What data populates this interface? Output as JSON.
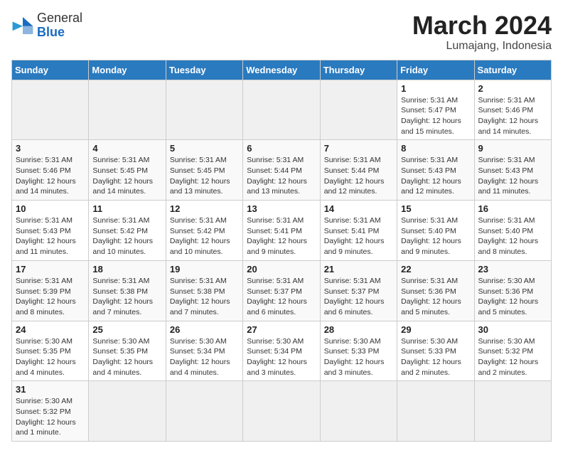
{
  "header": {
    "logo_general": "General",
    "logo_blue": "Blue",
    "month_year": "March 2024",
    "location": "Lumajang, Indonesia"
  },
  "days_of_week": [
    "Sunday",
    "Monday",
    "Tuesday",
    "Wednesday",
    "Thursday",
    "Friday",
    "Saturday"
  ],
  "weeks": [
    [
      {
        "day": "",
        "info": ""
      },
      {
        "day": "",
        "info": ""
      },
      {
        "day": "",
        "info": ""
      },
      {
        "day": "",
        "info": ""
      },
      {
        "day": "",
        "info": ""
      },
      {
        "day": "1",
        "info": "Sunrise: 5:31 AM\nSunset: 5:47 PM\nDaylight: 12 hours and 15 minutes."
      },
      {
        "day": "2",
        "info": "Sunrise: 5:31 AM\nSunset: 5:46 PM\nDaylight: 12 hours and 14 minutes."
      }
    ],
    [
      {
        "day": "3",
        "info": "Sunrise: 5:31 AM\nSunset: 5:46 PM\nDaylight: 12 hours and 14 minutes."
      },
      {
        "day": "4",
        "info": "Sunrise: 5:31 AM\nSunset: 5:45 PM\nDaylight: 12 hours and 14 minutes."
      },
      {
        "day": "5",
        "info": "Sunrise: 5:31 AM\nSunset: 5:45 PM\nDaylight: 12 hours and 13 minutes."
      },
      {
        "day": "6",
        "info": "Sunrise: 5:31 AM\nSunset: 5:44 PM\nDaylight: 12 hours and 13 minutes."
      },
      {
        "day": "7",
        "info": "Sunrise: 5:31 AM\nSunset: 5:44 PM\nDaylight: 12 hours and 12 minutes."
      },
      {
        "day": "8",
        "info": "Sunrise: 5:31 AM\nSunset: 5:43 PM\nDaylight: 12 hours and 12 minutes."
      },
      {
        "day": "9",
        "info": "Sunrise: 5:31 AM\nSunset: 5:43 PM\nDaylight: 12 hours and 11 minutes."
      }
    ],
    [
      {
        "day": "10",
        "info": "Sunrise: 5:31 AM\nSunset: 5:43 PM\nDaylight: 12 hours and 11 minutes."
      },
      {
        "day": "11",
        "info": "Sunrise: 5:31 AM\nSunset: 5:42 PM\nDaylight: 12 hours and 10 minutes."
      },
      {
        "day": "12",
        "info": "Sunrise: 5:31 AM\nSunset: 5:42 PM\nDaylight: 12 hours and 10 minutes."
      },
      {
        "day": "13",
        "info": "Sunrise: 5:31 AM\nSunset: 5:41 PM\nDaylight: 12 hours and 9 minutes."
      },
      {
        "day": "14",
        "info": "Sunrise: 5:31 AM\nSunset: 5:41 PM\nDaylight: 12 hours and 9 minutes."
      },
      {
        "day": "15",
        "info": "Sunrise: 5:31 AM\nSunset: 5:40 PM\nDaylight: 12 hours and 9 minutes."
      },
      {
        "day": "16",
        "info": "Sunrise: 5:31 AM\nSunset: 5:40 PM\nDaylight: 12 hours and 8 minutes."
      }
    ],
    [
      {
        "day": "17",
        "info": "Sunrise: 5:31 AM\nSunset: 5:39 PM\nDaylight: 12 hours and 8 minutes."
      },
      {
        "day": "18",
        "info": "Sunrise: 5:31 AM\nSunset: 5:38 PM\nDaylight: 12 hours and 7 minutes."
      },
      {
        "day": "19",
        "info": "Sunrise: 5:31 AM\nSunset: 5:38 PM\nDaylight: 12 hours and 7 minutes."
      },
      {
        "day": "20",
        "info": "Sunrise: 5:31 AM\nSunset: 5:37 PM\nDaylight: 12 hours and 6 minutes."
      },
      {
        "day": "21",
        "info": "Sunrise: 5:31 AM\nSunset: 5:37 PM\nDaylight: 12 hours and 6 minutes."
      },
      {
        "day": "22",
        "info": "Sunrise: 5:31 AM\nSunset: 5:36 PM\nDaylight: 12 hours and 5 minutes."
      },
      {
        "day": "23",
        "info": "Sunrise: 5:30 AM\nSunset: 5:36 PM\nDaylight: 12 hours and 5 minutes."
      }
    ],
    [
      {
        "day": "24",
        "info": "Sunrise: 5:30 AM\nSunset: 5:35 PM\nDaylight: 12 hours and 4 minutes."
      },
      {
        "day": "25",
        "info": "Sunrise: 5:30 AM\nSunset: 5:35 PM\nDaylight: 12 hours and 4 minutes."
      },
      {
        "day": "26",
        "info": "Sunrise: 5:30 AM\nSunset: 5:34 PM\nDaylight: 12 hours and 4 minutes."
      },
      {
        "day": "27",
        "info": "Sunrise: 5:30 AM\nSunset: 5:34 PM\nDaylight: 12 hours and 3 minutes."
      },
      {
        "day": "28",
        "info": "Sunrise: 5:30 AM\nSunset: 5:33 PM\nDaylight: 12 hours and 3 minutes."
      },
      {
        "day": "29",
        "info": "Sunrise: 5:30 AM\nSunset: 5:33 PM\nDaylight: 12 hours and 2 minutes."
      },
      {
        "day": "30",
        "info": "Sunrise: 5:30 AM\nSunset: 5:32 PM\nDaylight: 12 hours and 2 minutes."
      }
    ],
    [
      {
        "day": "31",
        "info": "Sunrise: 5:30 AM\nSunset: 5:32 PM\nDaylight: 12 hours and 1 minute."
      },
      {
        "day": "",
        "info": ""
      },
      {
        "day": "",
        "info": ""
      },
      {
        "day": "",
        "info": ""
      },
      {
        "day": "",
        "info": ""
      },
      {
        "day": "",
        "info": ""
      },
      {
        "day": "",
        "info": ""
      }
    ]
  ]
}
